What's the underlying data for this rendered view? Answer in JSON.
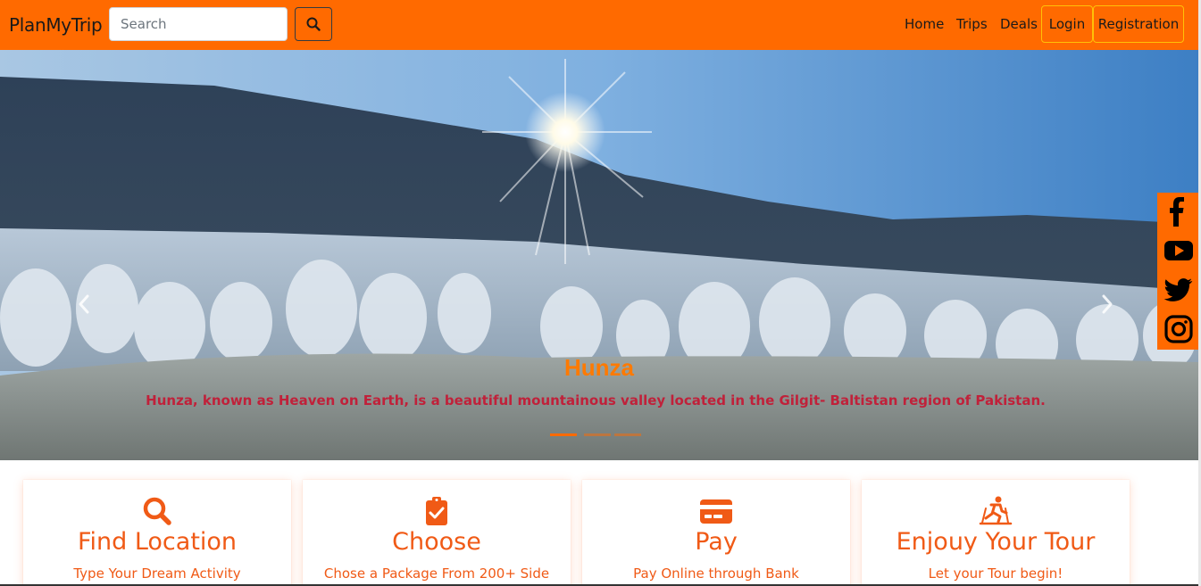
{
  "navbar": {
    "brand": "PlanMyTrip",
    "search_placeholder": "Search",
    "links": {
      "home": "Home",
      "trips": "Trips",
      "deals": "Deals"
    },
    "login_label": "Login",
    "registration_label": "Registration"
  },
  "hero": {
    "title": "Hunza",
    "description": "Hunza, known as Heaven on Earth, is a beautiful mountainous valley located in the Gilgit- Baltistan region of Pakistan.",
    "slide_count": 3,
    "active_slide": 1
  },
  "social": {
    "icons": [
      "facebook-icon",
      "youtube-icon",
      "twitter-icon",
      "instagram-icon"
    ]
  },
  "features": [
    {
      "icon": "search-icon",
      "title": "Find Location",
      "text": "Type Your Dream Activity"
    },
    {
      "icon": "clipboard-check-icon",
      "title": "Choose",
      "text": "Chose a Package From 200+ Side"
    },
    {
      "icon": "credit-card-icon",
      "title": "Pay",
      "text": "Pay Online through Bank"
    },
    {
      "icon": "skiing-icon",
      "title": "Enjouy Your Tour",
      "text": "Let your Tour begin!"
    }
  ],
  "colors": {
    "brand_orange": "#ff6a00",
    "feature_orange": "#f05a16",
    "caption_red": "#c0213a",
    "navbar_button_border": "#ffc107"
  }
}
